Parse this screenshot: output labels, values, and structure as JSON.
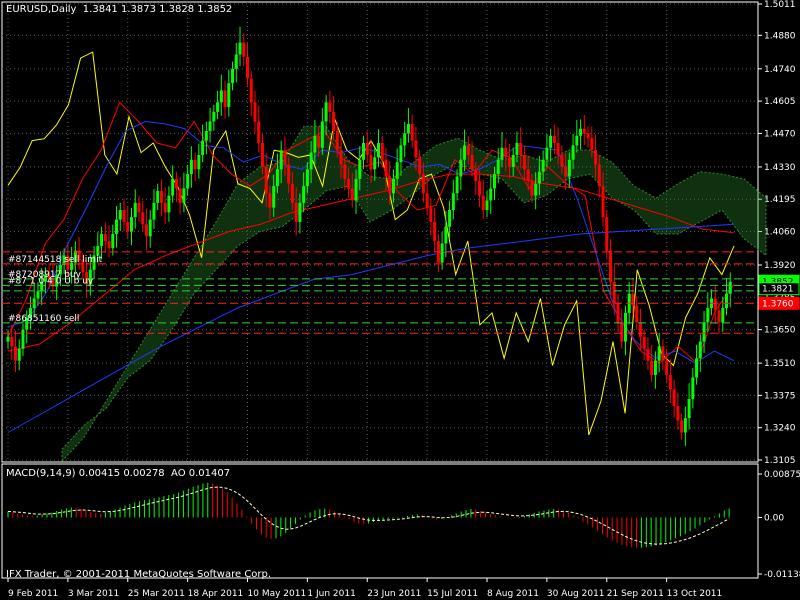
{
  "header": {
    "symbol": "EURUSD,Daily",
    "ohlc": "1.3841 1.3873 1.3828 1.3852"
  },
  "macd_header": {
    "label": "MACD(9,14,9)",
    "values": "0.00415 0.00278",
    "ao": "AO 0.01407"
  },
  "copyright": "IFX Trader, © 2001-2011 MetaQuotes Software Corp.",
  "colors": {
    "background": "#000000",
    "grid": "#5a5a5a",
    "frame": "#ffffff",
    "bull": "#00ff00",
    "bear": "#ff0000",
    "yellow_line": "#ffff00",
    "red_line": "#ff0000",
    "blue_line": "#1e3cff",
    "cloud": "#2e8b2e",
    "cloud_bear": "#c71585",
    "order_buy": "#32cd32",
    "order_sell": "#ff2020",
    "current_price": "#00ff00",
    "bid_tag": "#ff0000"
  },
  "chart_data": [
    {
      "type": "candlestick",
      "symbol": "EURUSD",
      "timeframe": "Daily",
      "ylim": [
        1.3105,
        1.5011
      ],
      "y_ticks": [
        "1.5011",
        "1.4880",
        "1.4740",
        "1.4605",
        "1.4470",
        "1.4330",
        "1.4195",
        "1.4060",
        "1.3920",
        "1.3785",
        "1.3650",
        "1.3510",
        "1.3375",
        "1.3240",
        "1.3105"
      ],
      "x_ticks": [
        "9 Feb 2011",
        "3 Mar 2011",
        "25 Mar 2011",
        "18 Apr 2011",
        "10 May 2011",
        "1 Jun 2011",
        "23 Jun 2011",
        "15 Jul 2011",
        "8 Aug 2011",
        "30 Aug 2011",
        "21 Sep 2011",
        "13 Oct 2011"
      ],
      "bars_per_tick": 16,
      "close": [
        1.362,
        1.358,
        1.352,
        1.357,
        1.365,
        1.37,
        1.374,
        1.378,
        1.381,
        1.385,
        1.388,
        1.386,
        1.383,
        1.388,
        1.392,
        1.396,
        1.39,
        1.393,
        1.398,
        1.394,
        1.389,
        1.384,
        1.39,
        1.396,
        1.4,
        1.405,
        1.402,
        1.399,
        1.405,
        1.411,
        1.415,
        1.41,
        1.406,
        1.412,
        1.418,
        1.414,
        1.409,
        1.404,
        1.411,
        1.418,
        1.423,
        1.418,
        1.414,
        1.421,
        1.428,
        1.424,
        1.418,
        1.424,
        1.43,
        1.436,
        1.432,
        1.438,
        1.444,
        1.448,
        1.452,
        1.456,
        1.46,
        1.465,
        1.458,
        1.468,
        1.474,
        1.48,
        1.485,
        1.479,
        1.47,
        1.46,
        1.452,
        1.443,
        1.433,
        1.422,
        1.416,
        1.425,
        1.432,
        1.44,
        1.434,
        1.426,
        1.418,
        1.41,
        1.418,
        1.425,
        1.432,
        1.439,
        1.446,
        1.441,
        1.452,
        1.46,
        1.456,
        1.448,
        1.44,
        1.434,
        1.428,
        1.424,
        1.419,
        1.428,
        1.436,
        1.443,
        1.438,
        1.432,
        1.437,
        1.443,
        1.436,
        1.429,
        1.422,
        1.428,
        1.435,
        1.442,
        1.447,
        1.451,
        1.444,
        1.437,
        1.43,
        1.422,
        1.416,
        1.41,
        1.402,
        1.393,
        1.401,
        1.408,
        1.415,
        1.422,
        1.429,
        1.436,
        1.442,
        1.438,
        1.432,
        1.427,
        1.421,
        1.415,
        1.419,
        1.424,
        1.43,
        1.436,
        1.441,
        1.437,
        1.433,
        1.438,
        1.443,
        1.438,
        1.432,
        1.427,
        1.421,
        1.426,
        1.431,
        1.436,
        1.441,
        1.446,
        1.443,
        1.438,
        1.433,
        1.429,
        1.436,
        1.442,
        1.446,
        1.449,
        1.447,
        1.445,
        1.44,
        1.434,
        1.425,
        1.412,
        1.398,
        1.385,
        1.376,
        1.368,
        1.36,
        1.372,
        1.38,
        1.375,
        1.368,
        1.362,
        1.357,
        1.352,
        1.346,
        1.352,
        1.358,
        1.352,
        1.346,
        1.34,
        1.333,
        1.327,
        1.322,
        1.328,
        1.336,
        1.345,
        1.353,
        1.36,
        1.368,
        1.374,
        1.378,
        1.373,
        1.368,
        1.374,
        1.38,
        1.385
      ]
    },
    {
      "type": "line",
      "series": [
        {
          "style": "yellow",
          "values": [
            1.4253,
            1.4328,
            1.444,
            1.4448,
            1.4505,
            1.459,
            1.4785,
            1.481,
            1.438,
            1.43,
            1.454,
            1.439,
            1.443,
            1.433,
            1.425,
            1.413,
            1.395,
            1.44,
            1.448,
            1.426,
            1.424,
            1.418,
            1.44,
            1.439,
            1.437,
            1.438,
            1.425,
            1.453,
            1.44,
            1.436,
            1.444,
            1.435,
            1.411,
            1.415,
            1.428,
            1.43,
            1.416,
            1.388,
            1.402,
            1.367,
            1.372,
            1.353,
            1.372,
            1.36,
            1.378,
            1.35,
            1.367,
            1.377,
            1.321,
            1.335,
            1.36,
            1.33,
            1.39,
            1.375,
            1.355,
            1.35,
            1.37,
            1.38,
            1.395,
            1.388,
            1.4
          ]
        },
        {
          "style": "red",
          "values": [
            1.362,
            1.378,
            1.401,
            1.411,
            1.428,
            1.44,
            1.46,
            1.452,
            1.443,
            1.441,
            1.452,
            1.438,
            1.43,
            1.425,
            1.43,
            1.44,
            1.444,
            1.448,
            1.436,
            1.433,
            1.435,
            1.422,
            1.415,
            1.417,
            1.436,
            1.43,
            1.44,
            1.437,
            1.424,
            1.433,
            1.426,
            1.421,
            1.381,
            1.368,
            1.356,
            1.351,
            1.358,
            1.351,
            1.373,
            1.384
          ]
        },
        {
          "style": "blue",
          "values": [
            1.366,
            1.369,
            1.381,
            1.4,
            1.416,
            1.433,
            1.448,
            1.452,
            1.451,
            1.449,
            1.442,
            1.441,
            1.435,
            1.438,
            1.434,
            1.432,
            1.44,
            1.439,
            1.441,
            1.439,
            1.436,
            1.433,
            1.434,
            1.43,
            1.432,
            1.436,
            1.442,
            1.441,
            1.44,
            1.42,
            1.396,
            1.372,
            1.36,
            1.353,
            1.356,
            1.351,
            1.356,
            1.352
          ]
        },
        {
          "style": "red_ma",
          "values": [
            1.356,
            1.359,
            1.368,
            1.379,
            1.39,
            1.396,
            1.401,
            1.406,
            1.409,
            1.414,
            1.417,
            1.42,
            1.423,
            1.427,
            1.43,
            1.43,
            1.429,
            1.426,
            1.424,
            1.42,
            1.416,
            1.412,
            1.407,
            1.4055
          ]
        },
        {
          "style": "blue_ma",
          "values": [
            1.322,
            1.331,
            1.34,
            1.349,
            1.358,
            1.366,
            1.374,
            1.38,
            1.386,
            1.388,
            1.392,
            1.396,
            1.399,
            1.401,
            1.403,
            1.405,
            1.406,
            1.407,
            1.408,
            1.409
          ]
        }
      ]
    },
    {
      "type": "area",
      "name": "cloud",
      "series": [
        {
          "name": "top",
          "values": [
            1.31,
            1.32,
            1.335,
            1.35,
            1.365,
            1.38,
            1.395,
            1.41,
            1.426,
            1.433,
            1.435,
            1.45,
            1.45,
            1.436,
            1.429,
            1.428,
            1.435,
            1.442,
            1.445,
            1.44,
            1.436,
            1.438,
            1.435,
            1.44,
            1.44,
            1.435,
            1.425,
            1.42,
            1.426,
            1.431,
            1.43,
            1.428,
            1.42
          ]
        },
        {
          "name": "bottom",
          "values": [
            1.315,
            1.325,
            1.332,
            1.345,
            1.352,
            1.365,
            1.38,
            1.39,
            1.4,
            1.406,
            1.408,
            1.415,
            1.423,
            1.425,
            1.41,
            1.415,
            1.422,
            1.43,
            1.435,
            1.43,
            1.428,
            1.418,
            1.421,
            1.428,
            1.43,
            1.42,
            1.415,
            1.405,
            1.405,
            1.41,
            1.415,
            1.403,
            1.396
          ]
        }
      ]
    },
    {
      "type": "hlines",
      "levels": [
        {
          "kind": "sell",
          "price": 1.3975
        },
        {
          "kind": "sell",
          "price": 1.3925
        },
        {
          "kind": "buy",
          "price": 1.3862
        },
        {
          "kind": "buy",
          "price": 1.3835
        },
        {
          "kind": "buy",
          "price": 1.3812
        },
        {
          "kind": "sell",
          "price": 1.376
        },
        {
          "kind": "buy",
          "price": 1.3678
        },
        {
          "kind": "sell",
          "price": 1.3635
        }
      ],
      "order_labels": [
        {
          "text": "#87144518 sell limit",
          "price": 1.3925
        },
        {
          "text": "#87208917 buy",
          "price": 1.3862
        },
        {
          "text": "#87 1 0 4 0 U b uy",
          "price": 1.3835
        },
        {
          "text": "#86851160 sell",
          "price": 1.3678
        }
      ],
      "price_tags": [
        {
          "text": "1.3852",
          "price": 1.3852,
          "style": "current"
        },
        {
          "text": "1.3821",
          "price": 1.3821,
          "style": "outline"
        },
        {
          "text": "1.3760",
          "price": 1.376,
          "style": "bid"
        }
      ]
    },
    {
      "type": "bar",
      "name": "MACD histogram",
      "ylim": [
        -0.01138,
        0.00875
      ],
      "y_ticks": [
        "0.00875",
        "0.00",
        "-0.01138"
      ],
      "values": [
        0.0012,
        0.001,
        0.0008,
        0.0006,
        0.0004,
        0.0003,
        0.0004,
        0.0006,
        0.0008,
        0.001,
        0.0013,
        0.0016,
        0.0018,
        0.002,
        0.0019,
        0.0017,
        0.0014,
        0.0011,
        0.0009,
        0.0008,
        0.001,
        0.0013,
        0.0016,
        0.002,
        0.0024,
        0.0027,
        0.003,
        0.0033,
        0.0035,
        0.0037,
        0.0039,
        0.0041,
        0.0043,
        0.0045,
        0.0047,
        0.005,
        0.0054,
        0.0058,
        0.0062,
        0.0065,
        0.0068,
        0.007,
        0.0068,
        0.0064,
        0.0058,
        0.005,
        0.004,
        0.0028,
        0.0015,
        0.0002,
        -0.0012,
        -0.0024,
        -0.0034,
        -0.004,
        -0.0043,
        -0.0042,
        -0.0038,
        -0.0031,
        -0.0022,
        -0.0013,
        -0.0004,
        0.0004,
        0.001,
        0.0014,
        0.0017,
        0.0018,
        0.0016,
        0.0012,
        0.0007,
        0.0002,
        -0.0004,
        -0.0009,
        -0.0012,
        -0.0013,
        -0.0012,
        -0.0009,
        -0.0006,
        -0.0004,
        -0.0003,
        -0.0002,
        -0.0001,
        0.0001,
        0.0003,
        0.0005,
        0.0006,
        0.0005,
        0.0002,
        -0.0002,
        -0.0004,
        -0.0003,
        0.0,
        0.0004,
        0.0008,
        0.0012,
        0.0015,
        0.0017,
        0.0016,
        0.0013,
        0.001,
        0.0007,
        0.0004,
        0.0002,
        0.0001,
        0.0,
        -0.0001,
        0.0001,
        0.0003,
        0.0006,
        0.0009,
        0.0012,
        0.0014,
        0.0016,
        0.0017,
        0.0016,
        0.0013,
        0.0009,
        0.0004,
        -0.0002,
        -0.0008,
        -0.0014,
        -0.002,
        -0.0027,
        -0.0034,
        -0.004,
        -0.0046,
        -0.0051,
        -0.0055,
        -0.0058,
        -0.006,
        -0.0061,
        -0.0061,
        -0.006,
        -0.0058,
        -0.0056,
        -0.0053,
        -0.005,
        -0.0046,
        -0.0042,
        -0.0038,
        -0.0033,
        -0.0028,
        -0.0022,
        -0.0016,
        -0.001,
        -0.0004,
        0.0002,
        0.0008,
        0.0014,
        0.0018
      ]
    }
  ]
}
